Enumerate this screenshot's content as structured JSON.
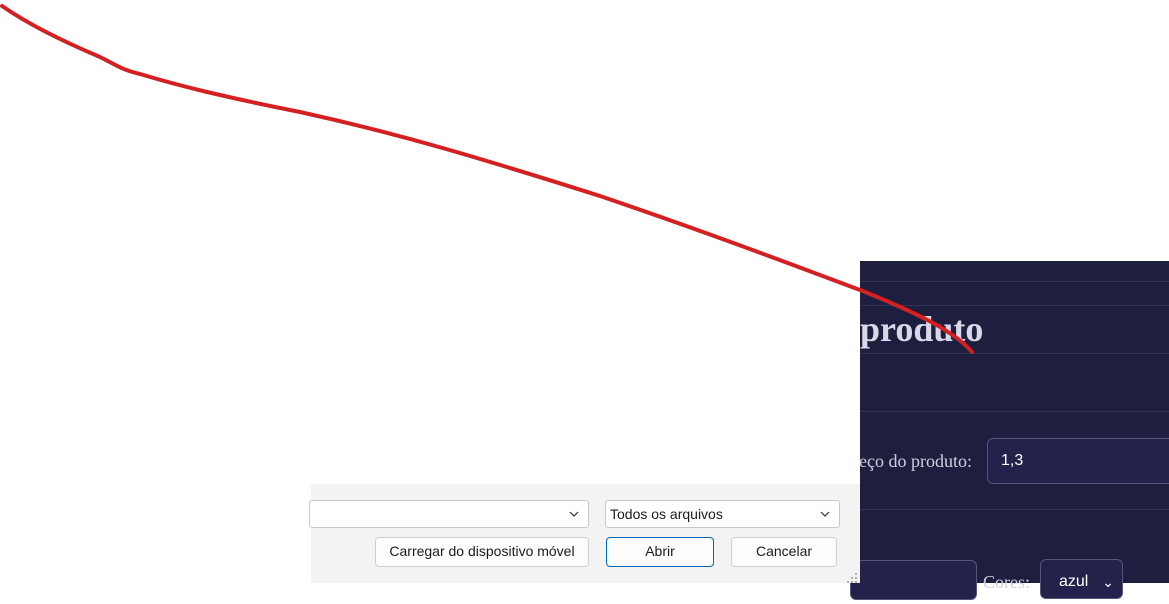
{
  "web_page": {
    "title_fragment": "produto",
    "price_label_fragment": "eço do produto:",
    "price_value": "1,3",
    "colors_label_fragment": "Cores:",
    "colors_selected": "azul",
    "background_color": "#1e1e3f"
  },
  "file_dialog": {
    "filename_value": "",
    "file_type_selected": "Todos os arquivos",
    "mobile_button_label": "Carregar do dispositivo móvel",
    "open_button_label": "Abrir",
    "cancel_button_label": "Cancelar"
  },
  "annotation": {
    "color": "#d42020",
    "type": "freehand-stroke"
  }
}
